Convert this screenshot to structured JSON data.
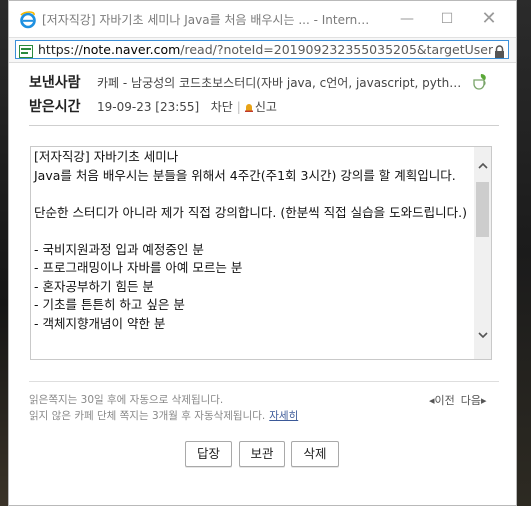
{
  "window": {
    "title": "[저자직강] 자바기초 세미나 Java를 처음 배우시는 ... - Intern…",
    "controls": {
      "minimize": "—",
      "maximize": "☐",
      "close": "✕"
    }
  },
  "address_bar": {
    "prefix": "https://",
    "domain": "note.naver.com",
    "rest": "/read/?noteId=201909232355035205&targetUserId=castello"
  },
  "header": {
    "sender_label": "보낸사람",
    "sender_value": "카페 - 남궁성의 코드초보스터디(자바 java, c언어, javascript, pyth…",
    "time_label": "받은시간",
    "time_value": "19-09-23 [23:55]",
    "block_label": "차단",
    "report_label": "신고"
  },
  "message": {
    "body": "[저자직강] 자바기초 세미나\nJava를 처음 배우시는 분들을 위해서 4주간(주1회 3시간) 강의를 할 계획입니다.\n\n단순한 스터디가 아니라 제가 직접 강의합니다. (한분씩 직접 실습을 도와드립니다.)\n\n- 국비지원과정 입과 예정중인 분\n- 프로그래밍이나 자바를 아예 모르는 분\n- 혼자공부하기 힘든 분\n- 기초를 튼튼히 하고 싶은 분\n- 객체지향개념이 약한 분"
  },
  "footer": {
    "notice1": "읽은쪽지는 30일 후에 자동으로 삭제됩니다.",
    "notice2": "읽지 않은 카페 단체 쪽지는 3개월 후 자동삭제됩니다.",
    "more_link": "자세히",
    "prev": "◂이전",
    "next": "다음▸"
  },
  "buttons": {
    "reply": "답장",
    "save": "보관",
    "delete": "삭제"
  }
}
